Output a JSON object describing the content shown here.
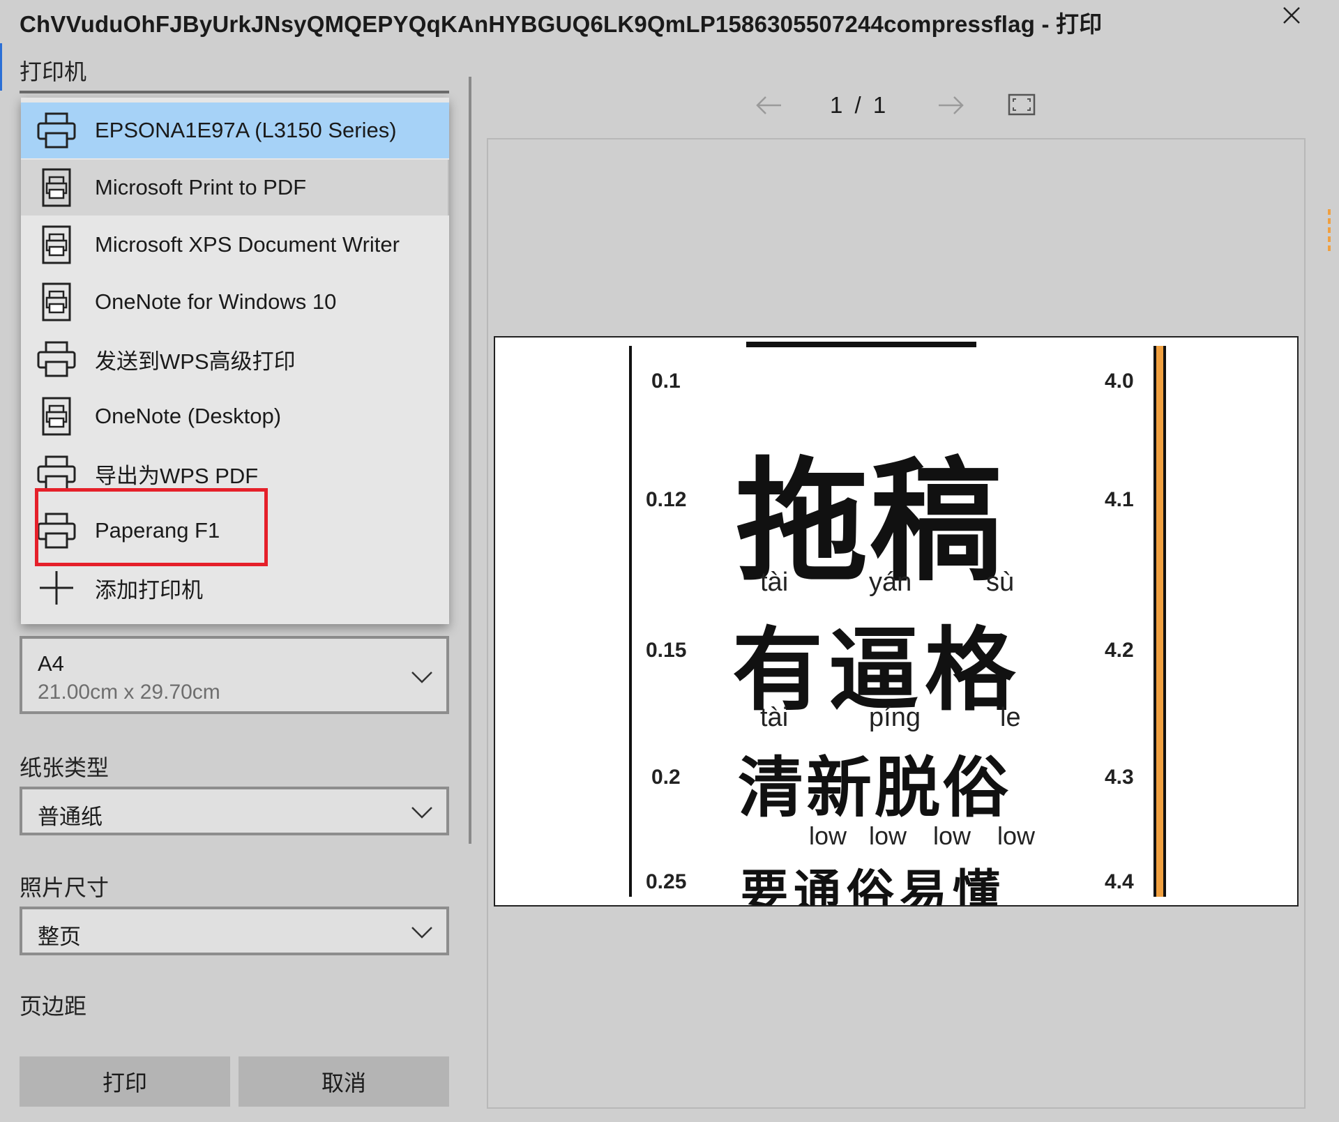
{
  "window": {
    "title": "ChVVuduOhFJByUrkJNsyQMQEPYQqKAnHYBGUQ6LK9QmLP1586305507244compressflag - 打印"
  },
  "labels": {
    "printer": "打印机",
    "paper_type": "纸张类型",
    "photo_size": "照片尺寸",
    "margins": "页边距"
  },
  "printers": [
    {
      "label": "EPSONA1E97A (L3150 Series)",
      "icon": "printer-icon",
      "state": "selected"
    },
    {
      "label": "Microsoft Print to PDF",
      "icon": "document-printer-icon",
      "state": "hover"
    },
    {
      "label": "Microsoft XPS Document Writer",
      "icon": "document-printer-icon",
      "state": ""
    },
    {
      "label": "OneNote for Windows 10",
      "icon": "document-printer-icon",
      "state": ""
    },
    {
      "label": "发送到WPS高级打印",
      "icon": "printer-icon",
      "state": ""
    },
    {
      "label": "OneNote (Desktop)",
      "icon": "document-printer-icon",
      "state": ""
    },
    {
      "label": "导出为WPS PDF",
      "icon": "printer-icon",
      "state": ""
    },
    {
      "label": "Paperang F1",
      "icon": "printer-icon",
      "state": "highlighted"
    },
    {
      "label": "添加打印机",
      "icon": "plus-icon",
      "state": ""
    }
  ],
  "paper_size": {
    "value": "A4",
    "detail": "21.00cm x 29.70cm"
  },
  "paper_type": {
    "value": "普通纸"
  },
  "photo_size": {
    "value": "整页"
  },
  "buttons": {
    "print": "打印",
    "cancel": "取消"
  },
  "pager": {
    "text": "1 / 1"
  },
  "preview": {
    "levels_left": [
      "0.1",
      "0.12",
      "0.15",
      "0.2",
      "0.25"
    ],
    "levels_right": [
      "4.0",
      "4.1",
      "4.2",
      "4.3",
      "4.4"
    ],
    "lines": [
      "拖稿",
      "有逼格",
      "清新脱俗",
      "要通俗易懂"
    ],
    "pinyin_1": [
      "tài",
      "yán",
      "sù"
    ],
    "pinyin_2": [
      "tài",
      "píng",
      "le"
    ],
    "pinyin_3": [
      "low",
      "low",
      "low",
      "low"
    ]
  },
  "colors": {
    "selected": "#a6d2f7",
    "highlight_box": "#e5202a",
    "accent_bar": "#f0a040"
  }
}
